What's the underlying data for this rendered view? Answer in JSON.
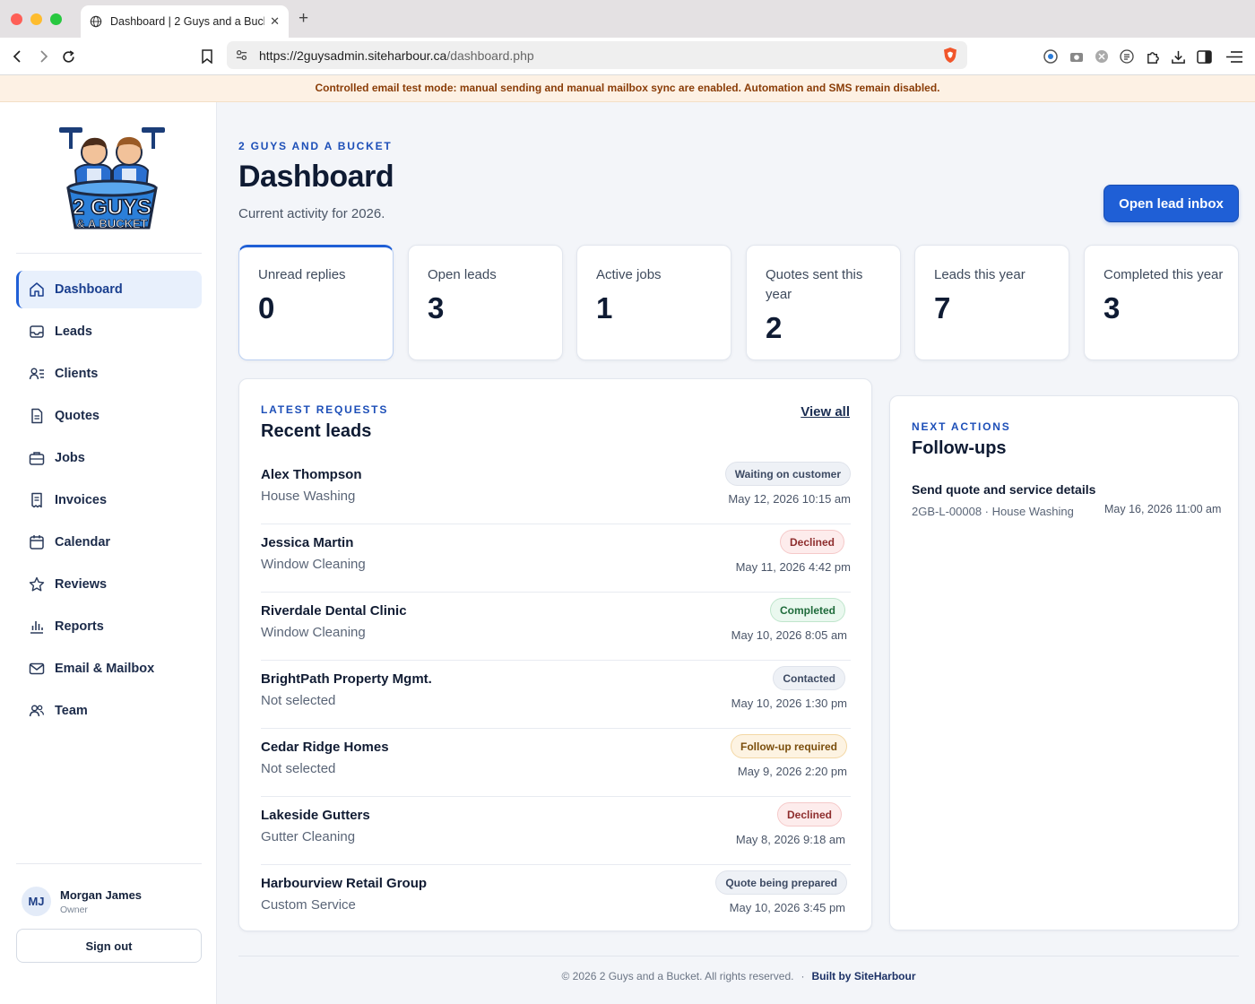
{
  "browser": {
    "tab_title": "Dashboard | 2 Guys and a Bucket",
    "url_host": "https://2guysadmin.siteharbour.ca",
    "url_path": "/dashboard.php"
  },
  "banner": "Controlled email test mode: manual sending and manual mailbox sync are enabled. Automation and SMS remain disabled.",
  "logo": {
    "line1": "2 GUYS",
    "line2": "& A BUCKET"
  },
  "sidebar": {
    "items": [
      {
        "label": "Dashboard",
        "icon": "home-icon"
      },
      {
        "label": "Leads",
        "icon": "inbox-icon"
      },
      {
        "label": "Clients",
        "icon": "clients-icon"
      },
      {
        "label": "Quotes",
        "icon": "document-icon"
      },
      {
        "label": "Jobs",
        "icon": "briefcase-icon"
      },
      {
        "label": "Invoices",
        "icon": "receipt-icon"
      },
      {
        "label": "Calendar",
        "icon": "calendar-icon"
      },
      {
        "label": "Reviews",
        "icon": "star-icon"
      },
      {
        "label": "Reports",
        "icon": "bar-chart-icon"
      },
      {
        "label": "Email & Mailbox",
        "icon": "mail-icon"
      },
      {
        "label": "Team",
        "icon": "team-icon"
      }
    ],
    "user": {
      "initials": "MJ",
      "name": "Morgan James",
      "role": "Owner"
    },
    "signout_label": "Sign out"
  },
  "header": {
    "eyebrow": "2 GUYS AND A BUCKET",
    "title": "Dashboard",
    "subtitle": "Current activity for 2026.",
    "primary_button": "Open lead inbox"
  },
  "stats": [
    {
      "label": "Unread replies",
      "value": "0"
    },
    {
      "label": "Open leads",
      "value": "3"
    },
    {
      "label": "Active jobs",
      "value": "1"
    },
    {
      "label": "Quotes sent this year",
      "value": "2"
    },
    {
      "label": "Leads this year",
      "value": "7"
    },
    {
      "label": "Completed this year",
      "value": "3"
    }
  ],
  "recent_leads": {
    "eyebrow": "LATEST REQUESTS",
    "title": "Recent leads",
    "view_all": "View all",
    "rows": [
      {
        "name": "Alex Thompson",
        "service": "House Washing",
        "status": "Waiting on customer",
        "date": "May 12, 2026 10:15 am"
      },
      {
        "name": "Jessica Martin",
        "service": "Window Cleaning",
        "status": "Declined",
        "date": "May 11, 2026 4:42 pm"
      },
      {
        "name": "Riverdale Dental Clinic",
        "service": "Window Cleaning",
        "status": "Completed",
        "date": "May 10, 2026 8:05 am"
      },
      {
        "name": "BrightPath Property Mgmt.",
        "service": "Not selected",
        "status": "Contacted",
        "date": "May 10, 2026 1:30 pm"
      },
      {
        "name": "Cedar Ridge Homes",
        "service": "Not selected",
        "status": "Follow-up required",
        "date": "May 9, 2026 2:20 pm"
      },
      {
        "name": "Lakeside Gutters",
        "service": "Gutter Cleaning",
        "status": "Declined",
        "date": "May 8, 2026 9:18 am"
      },
      {
        "name": "Harbourview Retail Group",
        "service": "Custom Service",
        "status": "Quote being prepared",
        "date": "May 10, 2026 3:45 pm"
      }
    ]
  },
  "followups": {
    "eyebrow": "NEXT ACTIONS",
    "title": "Follow-ups",
    "items": [
      {
        "title": "Send quote and service details",
        "meta": "2GB-L-00008 · House Washing",
        "date": "May 16, 2026 11:00 am"
      }
    ]
  },
  "footer": {
    "copyright": "© 2026 2 Guys and a Bucket. All rights reserved.",
    "separator": "·",
    "built_by": "Built by SiteHarbour"
  },
  "colors": {
    "accent": "#1f5fd6",
    "banner_bg": "#fdf1e4",
    "banner_text": "#8a3d08",
    "badge_declined": "#fdecec",
    "badge_completed": "#eaf8ef",
    "badge_followup": "#fdf3e2",
    "badge_neutral": "#eef1f6"
  }
}
